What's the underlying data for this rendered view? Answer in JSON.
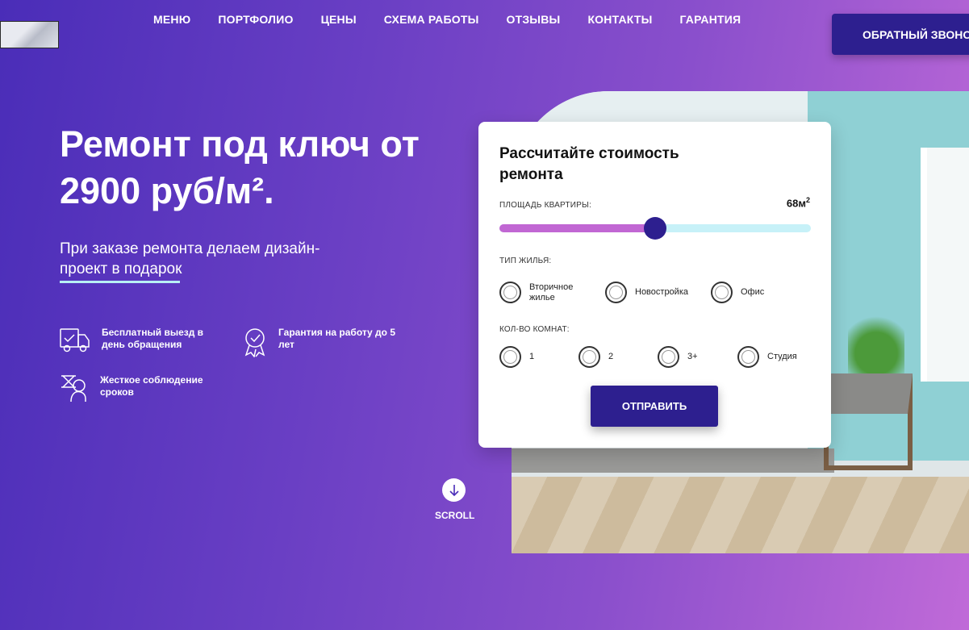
{
  "nav": {
    "items": [
      "МЕНЮ",
      "ПОРТФОЛИО",
      "ЦЕНЫ",
      "СХЕМА РАБОТЫ",
      "ОТЗЫВЫ",
      "КОНТАКТЫ",
      "ГАРАНТИЯ"
    ],
    "callback_label": "ОБРАТНЫЙ ЗВОНОК"
  },
  "hero": {
    "title": "Ремонт под ключ от 2900 руб/м².",
    "subtitle": "При заказе ремонта делаем дизайн-проект в подарок"
  },
  "features": [
    {
      "icon": "truck-icon",
      "text": "Бесплатный выезд в день обращения"
    },
    {
      "icon": "award-badge-icon",
      "text": "Гарантия на работу до 5 лет"
    },
    {
      "icon": "hourglass-head-icon",
      "text": "Жесткое соблюдение сроков"
    }
  ],
  "calculator": {
    "title": "Рассчитайте стоимость ремонта",
    "area_label": "ПЛОЩАДЬ КВАРТИРЫ:",
    "area_value": "68м",
    "area_unit_sup": "2",
    "slider_fraction": 0.5,
    "housing_label": "ТИП ЖИЛЬЯ:",
    "housing_options": [
      "Вторичное жилье",
      "Новостройка",
      "Офис"
    ],
    "rooms_label": "КОЛ-ВО КОМНАТ:",
    "rooms_options": [
      "1",
      "2",
      "3+",
      "Студия"
    ],
    "submit_label": "ОТПРАВИТЬ"
  },
  "scroll": {
    "label": "SCROLL",
    "icon": "arrow-down-circle-icon"
  },
  "colors": {
    "accent": "#2d1f8f",
    "slider_fill": "#c167d3",
    "slider_track": "#c7f1f8",
    "underline": "#b8f0f4"
  }
}
